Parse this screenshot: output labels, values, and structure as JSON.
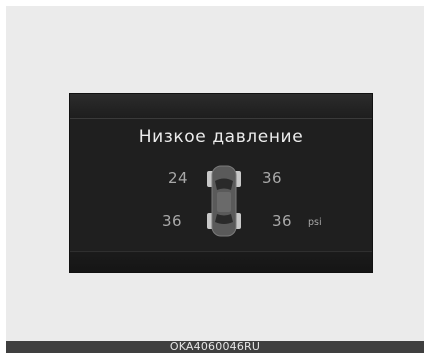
{
  "display": {
    "title": "Низкое давление",
    "tires": {
      "front_left": "24",
      "front_right": "36",
      "rear_left": "36",
      "rear_right": "36"
    },
    "unit": "psi",
    "car_icon": "car-top-view-icon"
  },
  "caption": "OKA4060046RU",
  "colors": {
    "screen_bg": "#1f1f1f",
    "text": "#a8a8a8",
    "title": "#ececec",
    "page_bg": "#ebebeb",
    "caption_bar": "#3f3f3f"
  }
}
